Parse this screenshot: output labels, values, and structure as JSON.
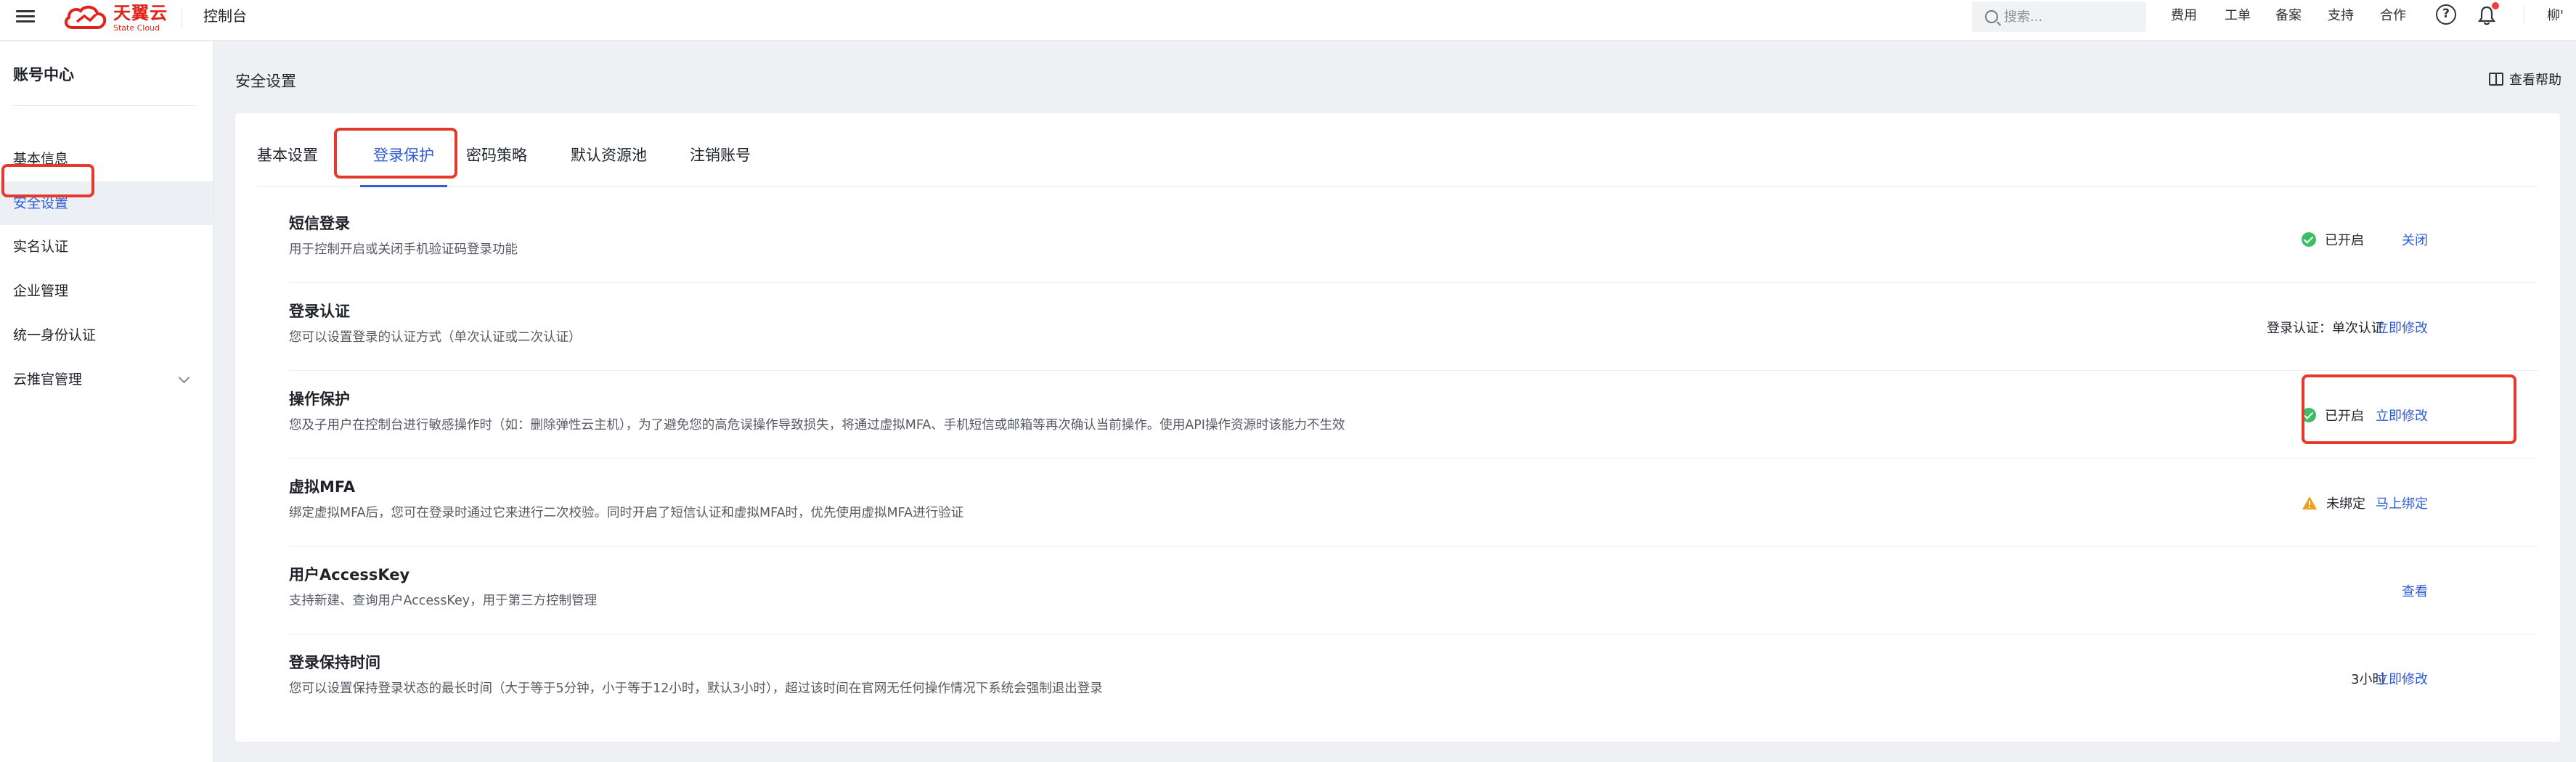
{
  "topbar": {
    "logo_main": "天翼云",
    "logo_sub": "State Cloud",
    "console_title": "控制台",
    "search_placeholder": "搜索...",
    "nav": [
      "费用",
      "工单",
      "备案",
      "支持",
      "合作"
    ],
    "user": "柳'"
  },
  "sidebar": {
    "title": "账号中心",
    "items": [
      {
        "label": "基本信息"
      },
      {
        "label": "安全设置"
      },
      {
        "label": "实名认证"
      },
      {
        "label": "企业管理"
      },
      {
        "label": "统一身份认证"
      },
      {
        "label": "云推官管理"
      }
    ]
  },
  "main": {
    "page_title": "安全设置",
    "help_link": "查看帮助",
    "tabs": [
      {
        "label": "基本设置"
      },
      {
        "label": "登录保护"
      },
      {
        "label": "密码策略"
      },
      {
        "label": "默认资源池"
      },
      {
        "label": "注销账号"
      }
    ],
    "active_tab": "登录保护",
    "rows": [
      {
        "title": "短信登录",
        "desc": "用于控制开启或关闭手机验证码登录功能",
        "status": "已开启",
        "action": "关闭"
      },
      {
        "title": "登录认证",
        "desc": "您可以设置登录的认证方式（单次认证或二次认证）",
        "status": "登录认证：单次认证",
        "action": "立即修改"
      },
      {
        "title": "操作保护",
        "desc": "您及子用户在控制台进行敏感操作时（如：删除弹性云主机），为了避免您的高危误操作导致损失，将通过虚拟MFA、手机短信或邮箱等再次确认当前操作。使用API操作资源时该能力不生效",
        "status": "已开启",
        "action": "立即修改"
      },
      {
        "title": "虚拟MFA",
        "desc": "绑定虚拟MFA后，您可在登录时通过它来进行二次校验。同时开启了短信认证和虚拟MFA时，优先使用虚拟MFA进行验证",
        "status": "未绑定",
        "action": "马上绑定"
      },
      {
        "title": "用户AccessKey",
        "desc": "支持新建、查询用户AccessKey，用于第三方控制管理",
        "status": "",
        "action": "查看"
      },
      {
        "title": "登录保持时间",
        "desc": "您可以设置保持登录状态的最长时间（大于等于5分钟，小于等于12小时，默认3小时），超过该时间在官网无任何操作情况下系统会强制退出登录",
        "status": "3小时",
        "action": "立即修改"
      }
    ]
  },
  "colors": {
    "accent": "#2f5cd6",
    "brand": "#e2231a",
    "success": "#3dbe66",
    "warning": "#f0a020",
    "annotation": "#e53a2b"
  }
}
